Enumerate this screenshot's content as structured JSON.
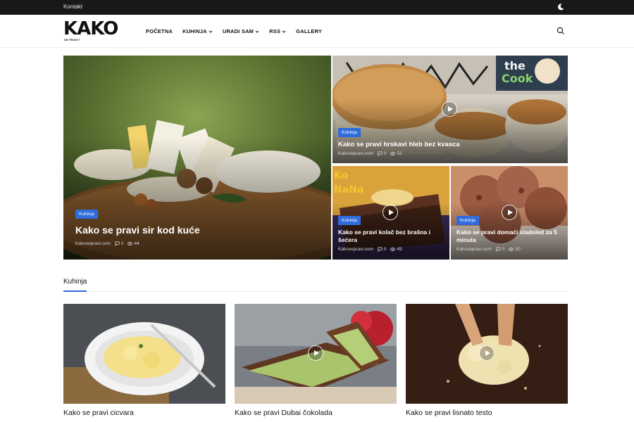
{
  "topbar": {
    "contact_label": "Kontakt"
  },
  "logo": {
    "wordmark": "KAKO",
    "tagline": "SE PRAVI?"
  },
  "nav": [
    {
      "label": "POČETNA",
      "dropdown": false
    },
    {
      "label": "KUHINJA",
      "dropdown": true
    },
    {
      "label": "URADI SAM",
      "dropdown": true
    },
    {
      "label": "RSS",
      "dropdown": true
    },
    {
      "label": "GALLERY",
      "dropdown": false
    }
  ],
  "hero": {
    "main": {
      "category": "Kuhinja",
      "title": "Kako se pravi sir kod kuće",
      "source": "Kakosepravi.com",
      "comments": "0",
      "views": "44"
    },
    "top_right": {
      "category": "Kuhinja",
      "title": "Kako se pravi hrskavi hleb bez kvasca",
      "source": "Kakosepravi.com",
      "comments": "0",
      "views": "52",
      "overlay_text": "the Cook"
    },
    "bottom_left": {
      "category": "Kuhinja",
      "title": "Kako se pravi kolač bez brašna i šećera",
      "source": "Kakosepravi.com",
      "comments": "0",
      "views": "49",
      "overlay_text": "KoNaNa"
    },
    "bottom_right": {
      "category": "Kuhinja",
      "title": "Kako se pravi domaći sladoled za 5 minuta",
      "source": "Kakosepravi.com",
      "comments": "0",
      "views": "50"
    }
  },
  "section": {
    "title": "Kuhinja"
  },
  "cards": [
    {
      "title": "Kako se pravi cicvara",
      "video": false
    },
    {
      "title": "Kako se pravi Dubai čokolada",
      "video": true
    },
    {
      "title": "Kako se pravi lisnato testo",
      "video": true
    }
  ],
  "colors": {
    "accent": "#2f6bdc",
    "topbar": "#181818"
  }
}
